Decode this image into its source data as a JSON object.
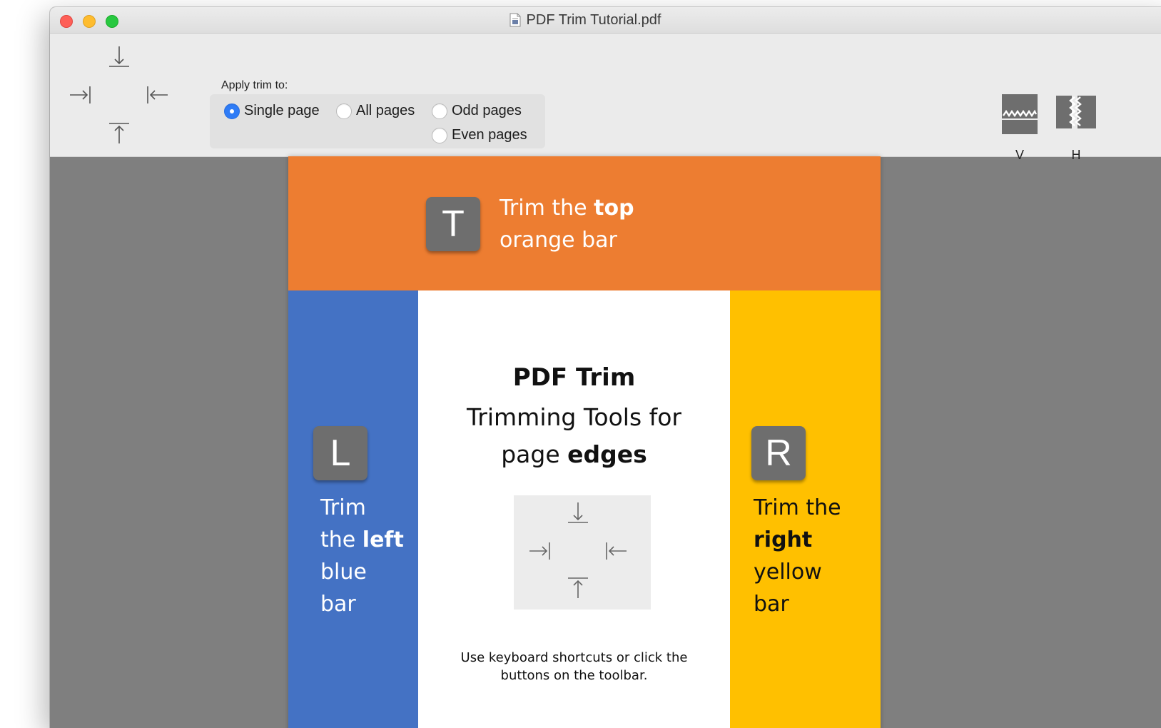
{
  "window": {
    "title": "PDF Trim Tutorial.pdf",
    "file_icon": "pdf-document-icon",
    "controls": [
      "close",
      "minimize",
      "maximize"
    ]
  },
  "toolbar": {
    "trim_buttons": [
      {
        "name": "trim-top",
        "icon": "arrow-down-to-bar-icon"
      },
      {
        "name": "trim-left",
        "icon": "arrow-right-to-bar-icon"
      },
      {
        "name": "trim-right",
        "icon": "arrow-left-to-bar-icon"
      },
      {
        "name": "trim-bottom",
        "icon": "arrow-up-to-bar-icon"
      }
    ],
    "apply_label": "Apply trim to:",
    "options": {
      "single": "Single page",
      "all": "All pages",
      "odd": "Odd pages",
      "even": "Even pages"
    },
    "selected_option": "Single page",
    "split_vertical_label": "V",
    "split_horizontal_label": "H"
  },
  "page": {
    "top_key": "T",
    "top_text_pre": "Trim the ",
    "top_text_bold": "top",
    "top_text_line2": "orange bar",
    "left_key": "L",
    "left_line1": "Trim",
    "left_line2_pre": "the ",
    "left_line2_bold": "left",
    "left_line3": "blue",
    "left_line4": "bar",
    "right_key": "R",
    "right_line1": "Trim the",
    "right_line2_bold": "right",
    "right_line3": "yellow",
    "right_line4": "bar",
    "center_title": "PDF Trim",
    "center_subtitle_line1": "Trimming Tools for",
    "center_subtitle_line2_pre": "page ",
    "center_subtitle_line2_bold": "edges",
    "caption_line1": "Use keyboard shortcuts or click the",
    "caption_line2": "buttons on the toolbar.",
    "colors": {
      "top": "#ed7d31",
      "left": "#4472c4",
      "right": "#ffc000"
    }
  }
}
